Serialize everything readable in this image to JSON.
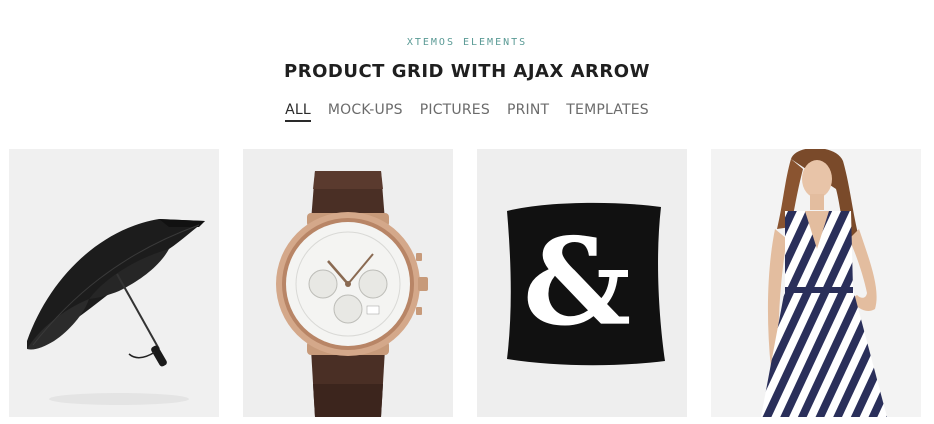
{
  "header": {
    "subtitle": "XTEMOS ELEMENTS",
    "title": "PRODUCT GRID WITH AJAX ARROW"
  },
  "filters": [
    {
      "label": "ALL",
      "active": true
    },
    {
      "label": "MOCK-UPS",
      "active": false
    },
    {
      "label": "PICTURES",
      "active": false
    },
    {
      "label": "PRINT",
      "active": false
    },
    {
      "label": "TEMPLATES",
      "active": false
    }
  ],
  "products": [
    {
      "image": "umbrella"
    },
    {
      "image": "watch"
    },
    {
      "image": "ampersand-pillow"
    },
    {
      "image": "striped-dress"
    }
  ],
  "colors": {
    "accent": "#5a9a95",
    "tile_background": "#efefef",
    "text": "#1f1f1f"
  }
}
